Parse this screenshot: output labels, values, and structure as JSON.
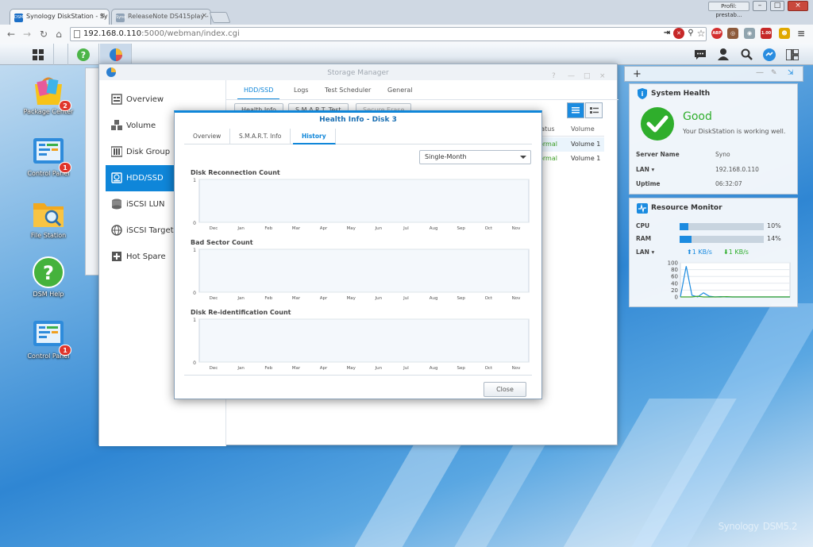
{
  "browser": {
    "tabs": [
      {
        "label": "Synology DiskStation - Sy",
        "favicon": "DSM"
      },
      {
        "label": "ReleaseNote DS415play -",
        "favicon": "Syno"
      }
    ],
    "profile": "Profil: prestab...",
    "address_host": "192.168.0.110",
    "address_path": ":5000/webman/index.cgi",
    "window_controls": [
      "minimize",
      "maximize",
      "close"
    ]
  },
  "desktop": {
    "icons": [
      {
        "label": "Package Center",
        "badge": "2"
      },
      {
        "label": "Control Panel",
        "badge": "1"
      },
      {
        "label": "File Station",
        "badge": ""
      },
      {
        "label": "DSM Help",
        "badge": ""
      },
      {
        "label": "Control Panel",
        "badge": "1"
      }
    ],
    "brand": "Synology",
    "brand_version": "DSM5.2"
  },
  "storage_manager": {
    "title": "Storage Manager",
    "sidebar": [
      {
        "label": "Overview",
        "icon": "overview-icon"
      },
      {
        "label": "Volume",
        "icon": "volume-icon"
      },
      {
        "label": "Disk Group",
        "icon": "disk-group-icon"
      },
      {
        "label": "HDD/SSD",
        "icon": "hdd-icon"
      },
      {
        "label": "iSCSI LUN",
        "icon": "iscsi-lun-icon"
      },
      {
        "label": "iSCSI Target",
        "icon": "iscsi-target-icon"
      },
      {
        "label": "Hot Spare",
        "icon": "hot-spare-icon"
      }
    ],
    "active_item": "HDD/SSD",
    "tabs": [
      "HDD/SSD",
      "Logs",
      "Test Scheduler",
      "General"
    ],
    "buttons": [
      "Health Info",
      "S.M.A.R.T. Test",
      "Secure Erase"
    ],
    "table": {
      "headers": [
        "Status",
        "Volume"
      ],
      "rows": [
        {
          "status": "Normal",
          "volume": "Volume 1"
        },
        {
          "status": "Normal",
          "volume": "Volume 1"
        }
      ]
    }
  },
  "health_modal": {
    "title": "Health Info - Disk 3",
    "tabs": [
      "Overview",
      "S.M.A.R.T. Info",
      "History"
    ],
    "active_tab": "History",
    "period": "Single-Month",
    "close_label": "Close"
  },
  "chart_data": [
    {
      "type": "line",
      "title": "Disk Reconnection Count",
      "categories": [
        "Dec",
        "Jan",
        "Feb",
        "Mar",
        "Apr",
        "May",
        "Jun",
        "Jul",
        "Aug",
        "Sep",
        "Oct",
        "Nov"
      ],
      "yticks": [
        0,
        1
      ],
      "ylim": [
        0,
        1
      ],
      "series": [],
      "grid": true
    },
    {
      "type": "line",
      "title": "Bad Sector Count",
      "categories": [
        "Dec",
        "Jan",
        "Feb",
        "Mar",
        "Apr",
        "May",
        "Jun",
        "Jul",
        "Aug",
        "Sep",
        "Oct",
        "Nov"
      ],
      "yticks": [
        0,
        1
      ],
      "ylim": [
        0,
        1
      ],
      "series": [],
      "grid": true
    },
    {
      "type": "line",
      "title": "Disk Re-identification Count",
      "categories": [
        "Dec",
        "Jan",
        "Feb",
        "Mar",
        "Apr",
        "May",
        "Jun",
        "Jul",
        "Aug",
        "Sep",
        "Oct",
        "Nov"
      ],
      "yticks": [
        0,
        1
      ],
      "ylim": [
        0,
        1
      ],
      "series": [],
      "grid": true
    },
    {
      "type": "line",
      "title": "",
      "yticks": [
        0,
        20,
        40,
        60,
        80,
        100
      ],
      "ylim": [
        0,
        100
      ],
      "series": [
        {
          "color": "#1c8be0",
          "values": [
            0,
            90,
            5,
            0,
            12,
            2,
            0,
            1,
            0,
            0,
            0,
            0,
            0,
            0,
            0,
            0,
            0,
            0,
            0,
            0
          ]
        },
        {
          "color": "#3aa52b",
          "values": [
            0,
            0,
            0,
            2,
            0,
            0,
            0,
            0,
            1,
            0,
            0,
            0,
            0,
            0,
            0,
            0,
            0,
            0,
            0,
            0
          ]
        }
      ]
    }
  ],
  "widgets": {
    "system_health": {
      "title": "System Health",
      "status": "Good",
      "message": "Your DiskStation is working well.",
      "rows": [
        {
          "label": "Server Name",
          "value": "Syno"
        },
        {
          "label": "LAN",
          "value": "192.168.0.110"
        },
        {
          "label": "Uptime",
          "value": "06:32:07"
        }
      ]
    },
    "resource_monitor": {
      "title": "Resource Monitor",
      "cpu_label": "CPU",
      "cpu_pct": 10,
      "cpu_text": "10%",
      "ram_label": "RAM",
      "ram_pct": 14,
      "ram_text": "14%",
      "lan_label": "LAN",
      "upload": "1 KB/s",
      "download": "1 KB/s"
    }
  },
  "colors": {
    "accent": "#0f86d9",
    "good": "#2fae2c",
    "normal": "#3a9d23"
  }
}
